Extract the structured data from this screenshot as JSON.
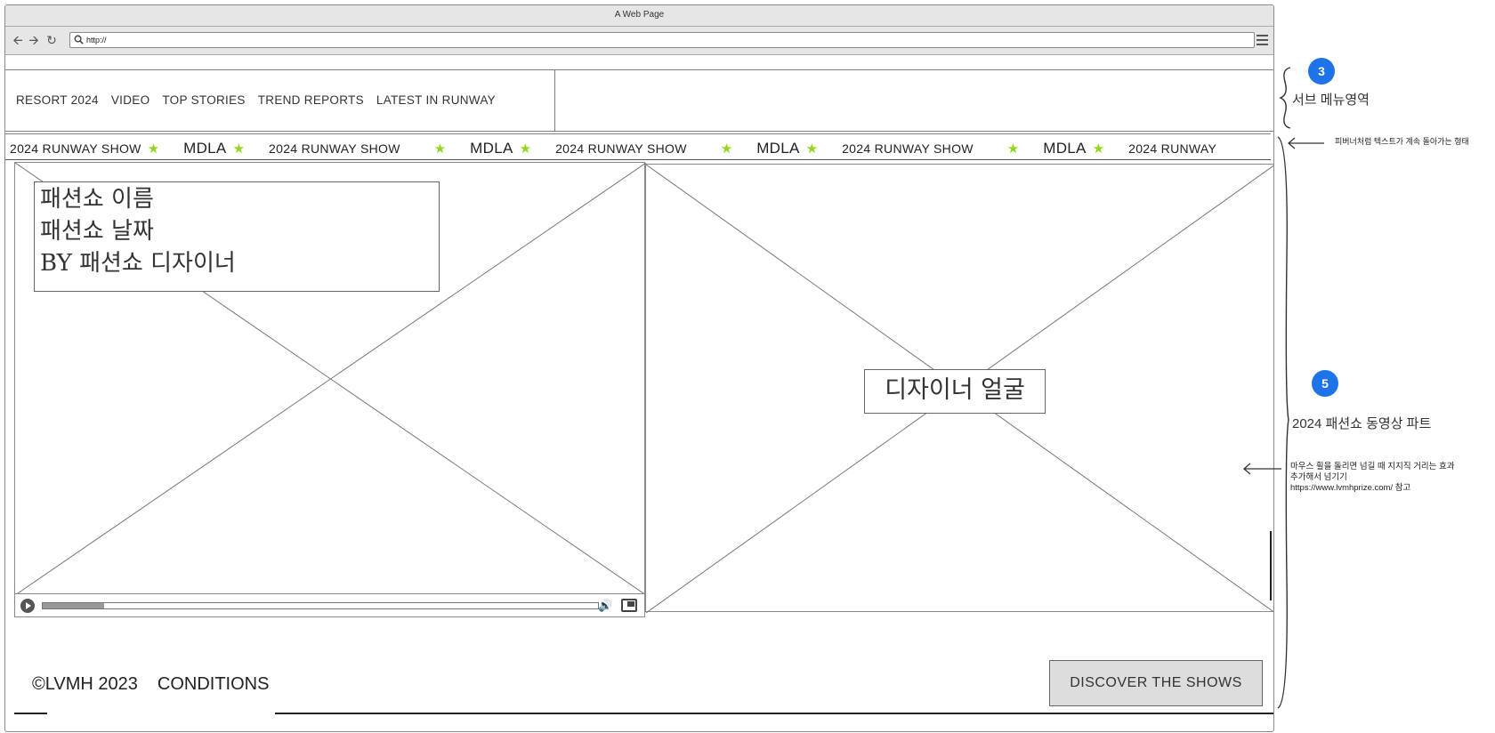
{
  "browser": {
    "title": "A Web Page",
    "url": "http://"
  },
  "nav": {
    "items": [
      {
        "label": "RESORT 2024"
      },
      {
        "label": "VIDEO"
      },
      {
        "label": "TOP STORIES"
      },
      {
        "label": "TREND REPORTS"
      },
      {
        "label": "LATEST IN RUNWAY"
      }
    ]
  },
  "ticker": {
    "items": [
      "2024 RUNWAY SHOW",
      "MDLA",
      "2024 RUNWAY SHOW",
      "MDLA",
      "2024 RUNWAY SHOW",
      "MDLA",
      "2024 RUNWAY SHOW",
      "MDLA",
      "2024 RUNWAY"
    ],
    "star_color": "#8fd81a"
  },
  "video": {
    "line1": "패션쇼 이름",
    "line2": "패션쇼 날짜",
    "line3": "BY 패션쇼 디자이너",
    "progress": 0.11
  },
  "designer": {
    "label": "디자이너 얼굴"
  },
  "footer": {
    "copyright": "©LVMH 2023",
    "conditions": "CONDITIONS",
    "discover": "DISCOVER THE SHOWS"
  },
  "annotations": {
    "badge3": "3",
    "submenu": "서브 메뉴영역",
    "ticker_note": "피버너처럼 텍스트가 계속 돌아가는 형태",
    "badge5": "5",
    "video_part": "2024 패션쇼 동영상 파트",
    "wheel_note_1": "마우스 휠을 돌리면 넘길 때 지지직 거리는 효과",
    "wheel_note_2": "추가해서 넘기기",
    "wheel_note_3": "https://www.lvmhprize.com/ 참고"
  },
  "colors": {
    "badge": "#1f73e8",
    "star": "#8fd81a"
  }
}
